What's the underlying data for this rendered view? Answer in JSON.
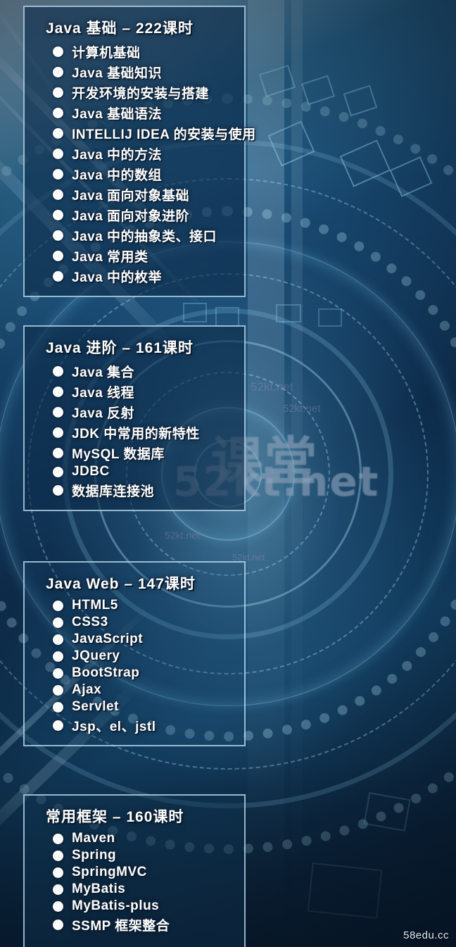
{
  "poster": {
    "theme_colors": {
      "panel_fill": "#0d2c4a",
      "panel_border": "#c4e6f8",
      "text": "#ffffff",
      "bullet": "#fdfdfd",
      "background_dark": "#0b2238",
      "background_light": "#b9d9ea"
    },
    "site_mark": "58edu.cc",
    "background_watermarks": [
      {
        "text": "课堂",
        "size": 74
      },
      {
        "text": "52kt.net",
        "size": 58
      },
      {
        "text": "52kt.net",
        "size": 17
      },
      {
        "text": "52kt.net",
        "size": 15
      },
      {
        "text": "52kt.net",
        "size": 14
      },
      {
        "text": "52kt.net",
        "size": 13
      }
    ],
    "sections": [
      {
        "title": "Java 基础 – 222课时",
        "course": "Java 基础",
        "hours": "222课时",
        "items": [
          "计算机基础",
          "Java 基础知识",
          "开发环境的安装与搭建",
          "Java 基础语法",
          "INTELLIJ IDEA 的安装与使用",
          "Java 中的方法",
          "Java 中的数组",
          "Java 面向对象基础",
          "Java 面向对象进阶",
          "Java 中的抽象类、接口",
          "Java 常用类",
          "Java 中的枚举"
        ]
      },
      {
        "title": "Java 进阶 – 161课时",
        "course": "Java 进阶",
        "hours": "161课时",
        "items": [
          "Java 集合",
          "Java 线程",
          "Java 反射",
          "JDK 中常用的新特性",
          "MySQL 数据库",
          "JDBC",
          "数据库连接池"
        ]
      },
      {
        "title": "Java Web – 147课时",
        "course": "Java Web",
        "hours": "147课时",
        "items": [
          "HTML5",
          "CSS3",
          "JavaScript",
          "JQuery",
          "BootStrap",
          "Ajax",
          "Servlet",
          "Jsp、el、jstl"
        ]
      },
      {
        "title": "常用框架 – 160课时",
        "course": "常用框架",
        "hours": "160课时",
        "items": [
          "Maven",
          "Spring",
          "SpringMVC",
          "MyBatis",
          "MyBatis-plus",
          "SSMP 框架整合"
        ]
      }
    ]
  }
}
